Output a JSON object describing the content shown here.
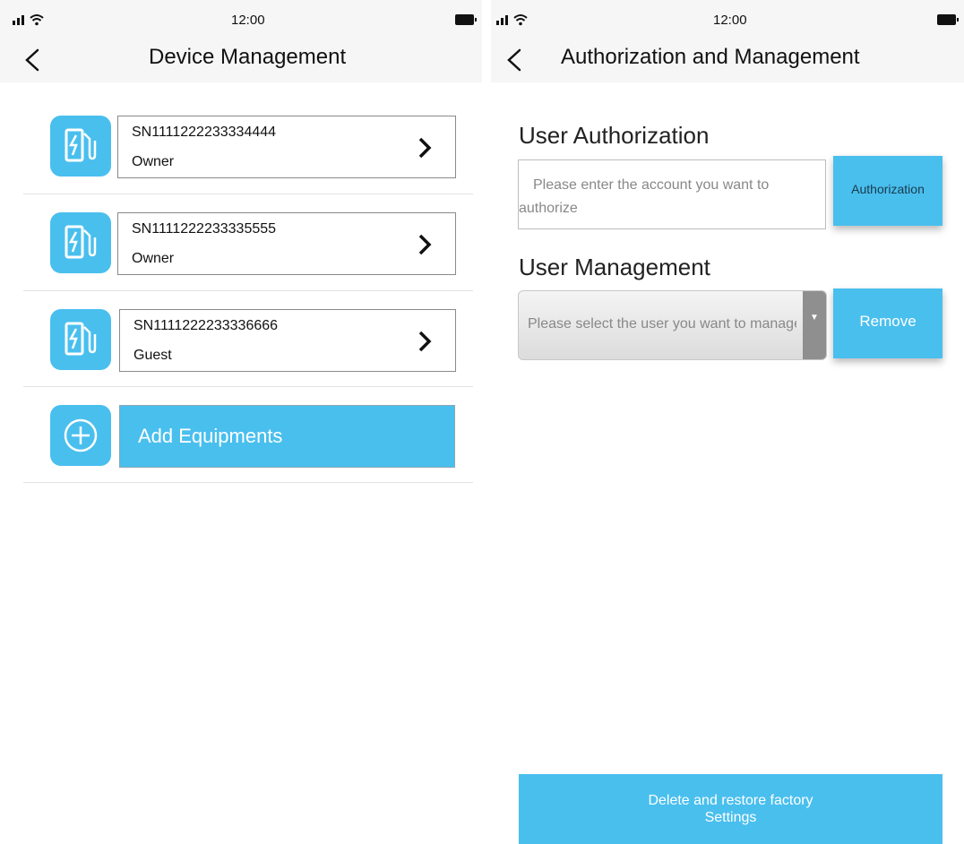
{
  "left_screen": {
    "status_time": "12:00",
    "title": "Device Management",
    "devices": [
      {
        "sn": "SN1111222233334444",
        "role": "Owner"
      },
      {
        "sn": "SN1111222233335555",
        "role": "Owner"
      },
      {
        "sn": "SN1111222233336666",
        "role": "Guest"
      }
    ],
    "add_label": "Add Equipments"
  },
  "right_screen": {
    "status_time": "12:00",
    "title": "Authorization and Management",
    "user_authorization": {
      "heading": "User Authorization",
      "placeholder_line1": "Please enter the account you want to",
      "placeholder_line2": "authorize",
      "button_label": "Authorization"
    },
    "user_management": {
      "heading": "User Management",
      "select_placeholder": "Please select the user you want to manage",
      "button_label": "Remove"
    },
    "factory_button": {
      "line1": "Delete and restore factory",
      "line2": "Settings"
    }
  },
  "colors": {
    "accent": "#49bfee",
    "navbar_bg": "#f6f6f6"
  },
  "icons": [
    "signal-icon",
    "wifi-icon",
    "battery-icon",
    "back-icon",
    "charging-station-icon",
    "chevron-right-icon",
    "add-circle-icon",
    "dropdown-arrow-icon"
  ]
}
